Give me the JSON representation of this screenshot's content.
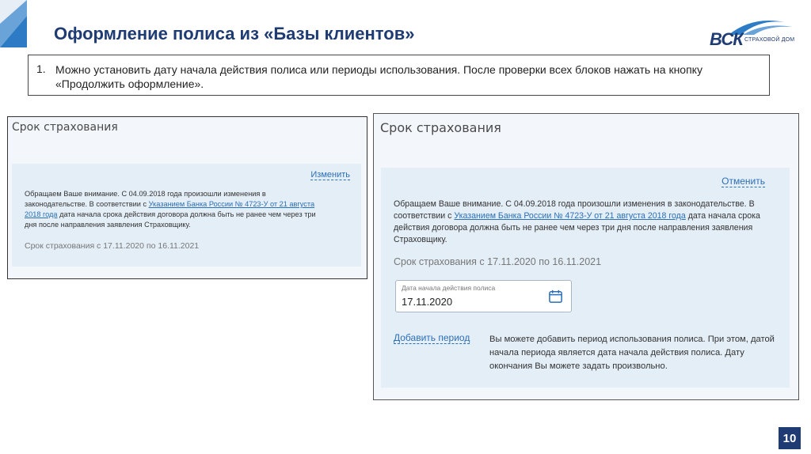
{
  "header": {
    "title": "Оформление полиса из «Базы клиентов»",
    "logo_text": "ВСК",
    "logo_subtext": "СТРАХОВОЙ ДОМ"
  },
  "instruction": {
    "number": "1.",
    "text": "Можно установить дату начала действия полиса или периоды использования. После проверки всех блоков нажать на кнопку «Продолжить оформление»."
  },
  "panel_before": {
    "title": "Срок страхования",
    "edit_link": "Изменить",
    "notice_prefix": "Обращаем Ваше внимание. С 04.09.2018 года произошли изменения в законодательстве. В соответствии с ",
    "notice_link": "Указанием Банка России № 4723-У от 21 августа 2018 года",
    "notice_suffix": " дата начала срока действия договора должна быть не ранее чем через три дня после направления заявления Страховщику.",
    "period_text": "Срок страхования с 17.11.2020 по 16.11.2021"
  },
  "panel_after": {
    "title": "Срок страхования",
    "cancel_link": "Отменить",
    "notice_prefix": "Обращаем Ваше внимание. С 04.09.2018 года произошли изменения в законодательстве. В соответствии с ",
    "notice_link": "Указанием Банка России № 4723-У от 21 августа 2018 года",
    "notice_suffix": " дата начала срока действия договора должна быть не ранее чем через три дня после направления заявления Страховщику.",
    "period_text": "Срок страхования с 17.11.2020 по 16.11.2021",
    "date_field_label": "Дата начала действия полиса",
    "date_field_value": "17.11.2020",
    "add_period_link": "Добавить период",
    "add_period_note": "Вы можете добавить период использования полиса. При этом, датой начала периода является дата начала действия полиса. Дату окончания Вы можете задать произвольно."
  },
  "footer": {
    "page_number": "10"
  },
  "colors": {
    "title": "#1f3b73",
    "link": "#2b6fb5",
    "panel_bg": "#f3f7fb",
    "inner_bg": "#e4eef7",
    "corner": "#2d7bc4"
  },
  "icons": {
    "corner": "corner-triangle-icon",
    "calendar": "calendar-icon",
    "logo": "vsk-logo-icon"
  }
}
